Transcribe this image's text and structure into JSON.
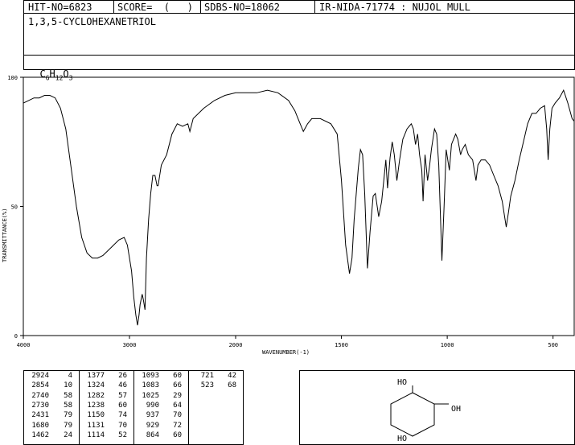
{
  "header": {
    "hit_no": "HIT-NO=6823",
    "score": "SCORE=  (   )",
    "sdbs_no": "SDBS-NO=18062",
    "ir_nida": "IR-NIDA-71774 : NUJOL MULL"
  },
  "compound": {
    "name": "1,3,5-CYCLOHEXANETRIOL",
    "formula_parts": [
      "C",
      "6",
      "H",
      "12",
      "O",
      "3"
    ]
  },
  "chart_data": {
    "type": "line",
    "xlabel": "WAVENUMBER(-1)",
    "ylabel": "TRANSMITTANCE(%)",
    "xlim": [
      4000,
      400
    ],
    "ylim": [
      0,
      100
    ],
    "x_ticks": [
      "4000",
      "3000",
      "2000",
      "1500",
      "1000",
      "500"
    ],
    "x_tick_values": [
      4000,
      3000,
      2000,
      1500,
      1000,
      500
    ],
    "y_ticks": [
      "100",
      "50",
      "0"
    ],
    "y_tick_values": [
      100,
      50,
      0
    ],
    "series": [
      {
        "points": [
          [
            4000,
            90
          ],
          [
            3950,
            91
          ],
          [
            3900,
            92
          ],
          [
            3850,
            92
          ],
          [
            3800,
            93
          ],
          [
            3750,
            93
          ],
          [
            3700,
            92
          ],
          [
            3650,
            88
          ],
          [
            3600,
            80
          ],
          [
            3550,
            65
          ],
          [
            3500,
            50
          ],
          [
            3450,
            38
          ],
          [
            3400,
            32
          ],
          [
            3350,
            30
          ],
          [
            3300,
            30
          ],
          [
            3250,
            31
          ],
          [
            3200,
            33
          ],
          [
            3150,
            35
          ],
          [
            3100,
            37
          ],
          [
            3050,
            38
          ],
          [
            3020,
            35
          ],
          [
            3000,
            30
          ],
          [
            2980,
            25
          ],
          [
            2960,
            15
          ],
          [
            2940,
            8
          ],
          [
            2924,
            4
          ],
          [
            2910,
            8
          ],
          [
            2900,
            12
          ],
          [
            2880,
            16
          ],
          [
            2870,
            14
          ],
          [
            2854,
            10
          ],
          [
            2840,
            30
          ],
          [
            2820,
            45
          ],
          [
            2800,
            55
          ],
          [
            2780,
            62
          ],
          [
            2760,
            62
          ],
          [
            2740,
            58
          ],
          [
            2730,
            58
          ],
          [
            2700,
            66
          ],
          [
            2650,
            70
          ],
          [
            2600,
            78
          ],
          [
            2550,
            82
          ],
          [
            2500,
            81
          ],
          [
            2450,
            82
          ],
          [
            2431,
            79
          ],
          [
            2400,
            84
          ],
          [
            2300,
            88
          ],
          [
            2200,
            91
          ],
          [
            2100,
            93
          ],
          [
            2000,
            94
          ],
          [
            1900,
            94
          ],
          [
            1850,
            95
          ],
          [
            1800,
            94
          ],
          [
            1750,
            91
          ],
          [
            1720,
            87
          ],
          [
            1700,
            83
          ],
          [
            1680,
            79
          ],
          [
            1660,
            82
          ],
          [
            1640,
            84
          ],
          [
            1600,
            84
          ],
          [
            1550,
            82
          ],
          [
            1520,
            78
          ],
          [
            1500,
            60
          ],
          [
            1480,
            35
          ],
          [
            1462,
            24
          ],
          [
            1450,
            30
          ],
          [
            1440,
            45
          ],
          [
            1420,
            65
          ],
          [
            1410,
            72
          ],
          [
            1400,
            70
          ],
          [
            1390,
            55
          ],
          [
            1377,
            26
          ],
          [
            1365,
            40
          ],
          [
            1350,
            54
          ],
          [
            1340,
            55
          ],
          [
            1324,
            46
          ],
          [
            1310,
            52
          ],
          [
            1300,
            60
          ],
          [
            1290,
            68
          ],
          [
            1282,
            57
          ],
          [
            1270,
            69
          ],
          [
            1260,
            75
          ],
          [
            1250,
            70
          ],
          [
            1238,
            60
          ],
          [
            1225,
            68
          ],
          [
            1210,
            76
          ],
          [
            1190,
            80
          ],
          [
            1170,
            82
          ],
          [
            1160,
            80
          ],
          [
            1150,
            74
          ],
          [
            1140,
            78
          ],
          [
            1131,
            70
          ],
          [
            1120,
            64
          ],
          [
            1114,
            52
          ],
          [
            1105,
            70
          ],
          [
            1100,
            66
          ],
          [
            1093,
            60
          ],
          [
            1083,
            66
          ],
          [
            1075,
            72
          ],
          [
            1060,
            80
          ],
          [
            1050,
            78
          ],
          [
            1040,
            66
          ],
          [
            1025,
            29
          ],
          [
            1015,
            50
          ],
          [
            1005,
            72
          ],
          [
            990,
            64
          ],
          [
            980,
            74
          ],
          [
            960,
            78
          ],
          [
            950,
            76
          ],
          [
            937,
            70
          ],
          [
            929,
            72
          ],
          [
            915,
            74
          ],
          [
            900,
            70
          ],
          [
            880,
            68
          ],
          [
            864,
            60
          ],
          [
            855,
            66
          ],
          [
            840,
            68
          ],
          [
            820,
            68
          ],
          [
            800,
            66
          ],
          [
            780,
            62
          ],
          [
            760,
            58
          ],
          [
            740,
            52
          ],
          [
            721,
            42
          ],
          [
            710,
            48
          ],
          [
            700,
            54
          ],
          [
            680,
            60
          ],
          [
            660,
            68
          ],
          [
            640,
            75
          ],
          [
            620,
            82
          ],
          [
            600,
            86
          ],
          [
            580,
            86
          ],
          [
            560,
            88
          ],
          [
            540,
            89
          ],
          [
            530,
            80
          ],
          [
            523,
            68
          ],
          [
            515,
            80
          ],
          [
            505,
            88
          ],
          [
            490,
            90
          ],
          [
            470,
            92
          ],
          [
            450,
            95
          ],
          [
            430,
            90
          ],
          [
            410,
            84
          ],
          [
            400,
            83
          ]
        ]
      }
    ]
  },
  "peak_table": [
    [
      [
        "2924",
        "4"
      ],
      [
        "2854",
        "10"
      ],
      [
        "2740",
        "58"
      ],
      [
        "2730",
        "58"
      ],
      [
        "2431",
        "79"
      ],
      [
        "1680",
        "79"
      ],
      [
        "1462",
        "24"
      ]
    ],
    [
      [
        "1377",
        "26"
      ],
      [
        "1324",
        "46"
      ],
      [
        "1282",
        "57"
      ],
      [
        "1238",
        "60"
      ],
      [
        "1150",
        "74"
      ],
      [
        "1131",
        "70"
      ],
      [
        "1114",
        "52"
      ]
    ],
    [
      [
        "1093",
        "60"
      ],
      [
        "1083",
        "66"
      ],
      [
        "1025",
        "29"
      ],
      [
        "990",
        "64"
      ],
      [
        "937",
        "70"
      ],
      [
        "929",
        "72"
      ],
      [
        "864",
        "60"
      ]
    ],
    [
      [
        "721",
        "42"
      ],
      [
        "523",
        "68"
      ]
    ]
  ],
  "structure": {
    "labels": [
      "HO",
      "OH",
      "HO"
    ]
  }
}
